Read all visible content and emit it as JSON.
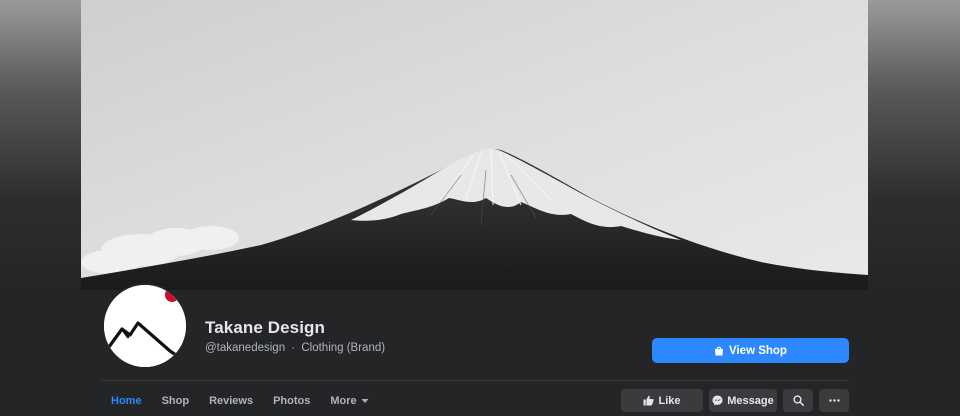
{
  "page": {
    "name": "Takane Design",
    "handle": "@takanedesign",
    "separator": "·",
    "category": "Clothing (Brand)"
  },
  "cover": {
    "image_description_icon": "mountain-cover-photo"
  },
  "buttons": {
    "view_shop": "View Shop",
    "like": "Like",
    "message": "Message"
  },
  "tabs": [
    {
      "label": "Home",
      "active": true
    },
    {
      "label": "Shop",
      "active": false
    },
    {
      "label": "Reviews",
      "active": false
    },
    {
      "label": "Photos",
      "active": false
    },
    {
      "label": "More",
      "active": false
    }
  ],
  "icons": {
    "view_shop": "shopping-bag-icon",
    "like": "thumbs-up-icon",
    "message": "messenger-icon",
    "search": "search-icon",
    "more": "ellipsis-icon",
    "more_tab": "caret-down-icon"
  },
  "colors": {
    "accent": "#2d88ff",
    "background": "#242526",
    "button": "#3a3b3c",
    "text_primary": "#e4e6eb",
    "text_secondary": "#b0b3b8",
    "logo_dot": "#c8102e"
  }
}
